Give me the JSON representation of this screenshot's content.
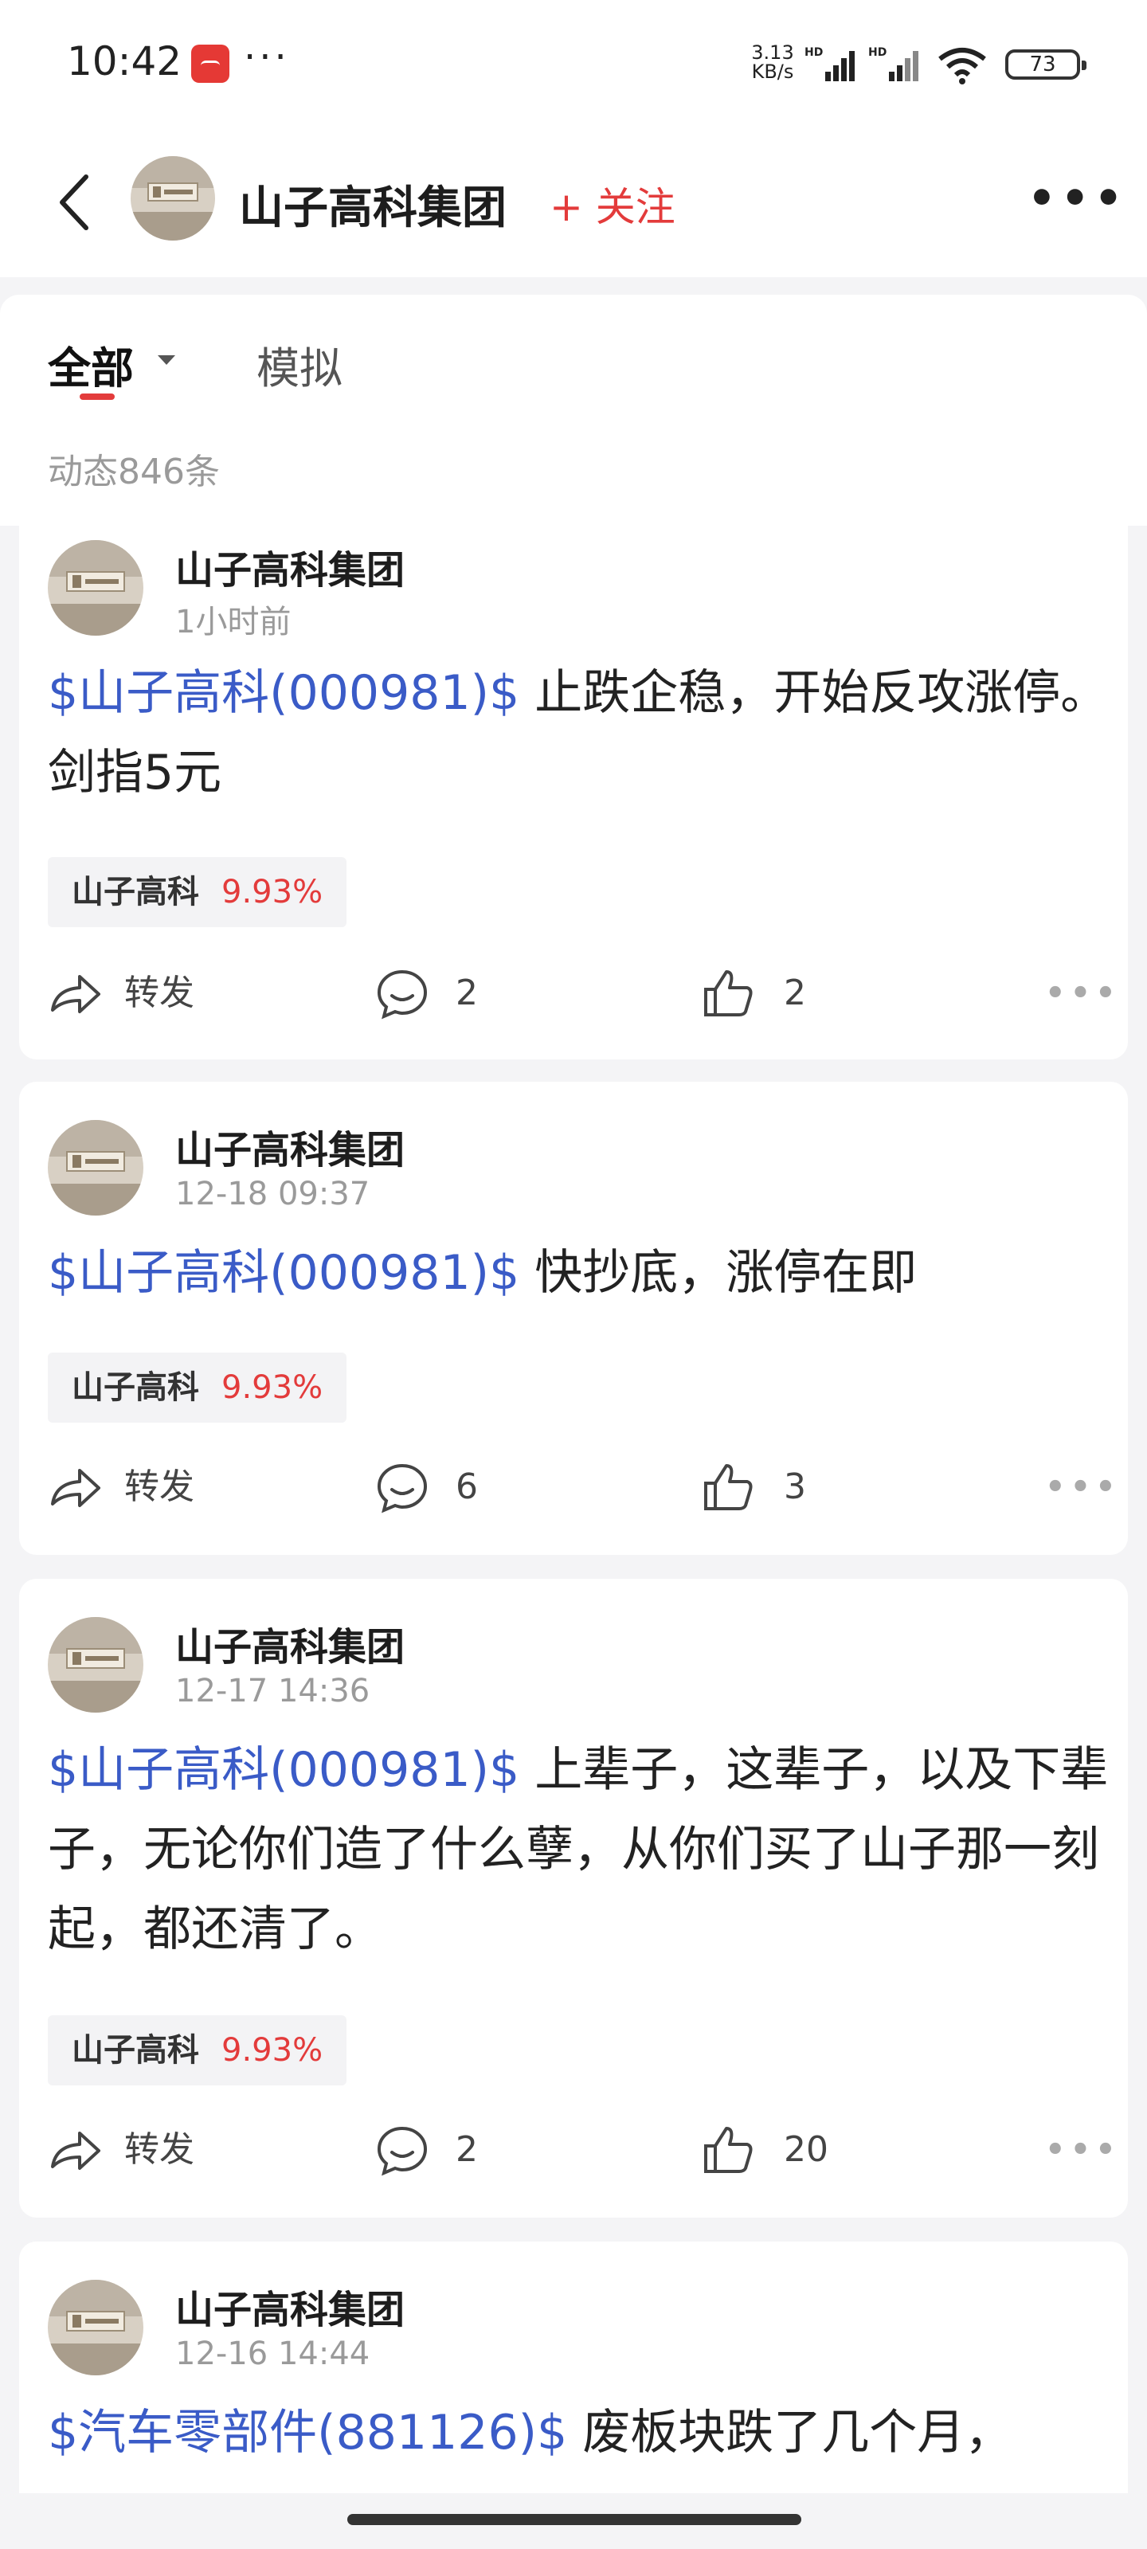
{
  "status_bar": {
    "time": "10:42",
    "more": "···",
    "net_speed_value": "3.13",
    "net_speed_unit": "KB/s",
    "battery": "73",
    "icons": [
      "app-notification-icon",
      "signal-icon",
      "wifi-icon",
      "battery-icon"
    ]
  },
  "header": {
    "title": "山子高科集团",
    "follow_label": "+ 关注",
    "more": "•••"
  },
  "tabs": {
    "all": "全部",
    "simulated": "模拟",
    "count": "动态846条"
  },
  "posts": [
    {
      "author": "山子高科集团",
      "time": "1小时前",
      "tag": "$山子高科(000981)$",
      "text": " 止跌企稳，开始反攻涨停。剑指5元",
      "stock_name": "山子高科",
      "stock_change": "9.93%",
      "repost": "转发",
      "comments": "2",
      "likes": "2"
    },
    {
      "author": "山子高科集团",
      "time": "12-18 09:37",
      "tag": "$山子高科(000981)$",
      "text": " 快抄底，涨停在即",
      "stock_name": "山子高科",
      "stock_change": "9.93%",
      "repost": "转发",
      "comments": "6",
      "likes": "3"
    },
    {
      "author": "山子高科集团",
      "time": "12-17 14:36",
      "tag": "$山子高科(000981)$",
      "text": " 上辈子，这辈子，以及下辈子，无论你们造了什么孽，从你们买了山子那一刻起，都还清了。",
      "stock_name": "山子高科",
      "stock_change": "9.93%",
      "repost": "转发",
      "comments": "2",
      "likes": "20"
    },
    {
      "author": "山子高科集团",
      "time": "12-16 14:44",
      "tag": "$汽车零部件(881126)$",
      "text": " 废板块跌了几个月，"
    }
  ],
  "colors": {
    "accent_red": "#e33b3b",
    "stock_tag_blue": "#3a5bc7"
  }
}
